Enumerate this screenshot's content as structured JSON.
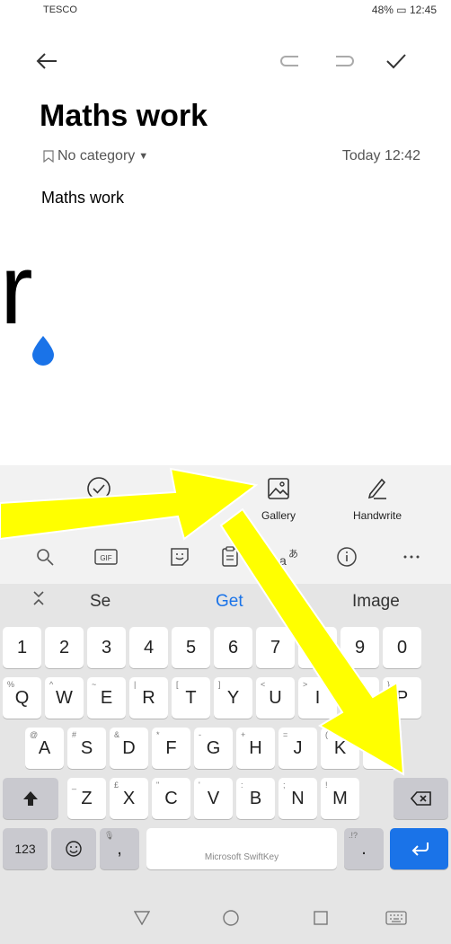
{
  "status_bar": {
    "carrier": "TESCO",
    "battery": "48%",
    "time": "12:45"
  },
  "note": {
    "title": "Maths work",
    "category": "No category",
    "timestamp": "Today 12:42",
    "body": "Maths work",
    "handwriting_glyph": "r"
  },
  "tools": [
    {
      "label": ""
    },
    {
      "label": "Gallery"
    },
    {
      "label": "Handwrite"
    }
  ],
  "keyboard": {
    "predictions": [
      "Se",
      "Get",
      "Image"
    ],
    "number_row": [
      "1",
      "2",
      "3",
      "4",
      "5",
      "6",
      "7",
      "8",
      "9",
      "0"
    ],
    "row1": [
      {
        "k": "Q",
        "s": "%"
      },
      {
        "k": "W",
        "s": "^"
      },
      {
        "k": "E",
        "s": "~"
      },
      {
        "k": "R",
        "s": "|"
      },
      {
        "k": "T",
        "s": "["
      },
      {
        "k": "Y",
        "s": "]"
      },
      {
        "k": "U",
        "s": "<"
      },
      {
        "k": "I",
        "s": ">"
      },
      {
        "k": "O",
        "s": "{"
      },
      {
        "k": "P",
        "s": "}"
      }
    ],
    "row2": [
      {
        "k": "A",
        "s": "@"
      },
      {
        "k": "S",
        "s": "#"
      },
      {
        "k": "D",
        "s": "&"
      },
      {
        "k": "F",
        "s": "*"
      },
      {
        "k": "G",
        "s": "-"
      },
      {
        "k": "H",
        "s": "+"
      },
      {
        "k": "J",
        "s": "="
      },
      {
        "k": "K",
        "s": "("
      },
      {
        "k": "L",
        "s": ")"
      }
    ],
    "row3": [
      {
        "k": "Z",
        "s": "_"
      },
      {
        "k": "X",
        "s": "£"
      },
      {
        "k": "C",
        "s": "\""
      },
      {
        "k": "V",
        "s": "'"
      },
      {
        "k": "B",
        "s": ":"
      },
      {
        "k": "N",
        "s": ";"
      },
      {
        "k": "M",
        "s": "!"
      }
    ],
    "mode_key": "123",
    "comma": ",",
    "period": ".",
    "space_brand": "Microsoft SwiftKey"
  },
  "colors": {
    "accent": "#1a73e8",
    "arrow": "#ffff00",
    "cursor": "#1a73e8"
  }
}
